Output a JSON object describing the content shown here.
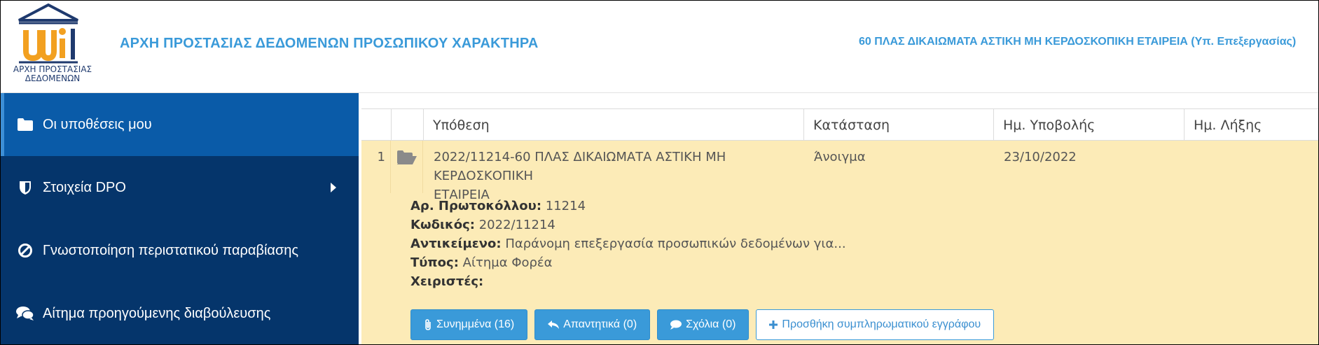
{
  "header": {
    "logo_caption_line1": "ΑΡΧΗ ΠΡΟΣΤΑΣΙΑΣ",
    "logo_caption_line2": "ΔΕΔΟΜΕΝΩΝ",
    "site_title": "ΑΡΧΗ ΠΡΟΣΤΑΣΙΑΣ ΔΕΔΟΜΕΝΩΝ ΠΡΟΣΩΠΙΚΟΥ ΧΑΡΑΚΤΗΡΑ",
    "org_title": "60 ΠΛΑΣ ΔΙΚΑΙΩΜΑΤΑ ΑΣΤΙΚΗ ΜΗ ΚΕΡΔΟΣΚΟΠΙΚΗ ΕΤΑΙΡΕΙΑ (Υπ. Επεξεργασίας)"
  },
  "sidebar": {
    "items": [
      {
        "label": "Οι υποθέσεις μου",
        "icon": "folder-icon",
        "active": true
      },
      {
        "label": "Στοιχεία DPO",
        "icon": "shield-icon",
        "has_submenu": true
      },
      {
        "label": "Γνωστοποίηση περιστατικού παραβίασης",
        "icon": "ban-icon"
      },
      {
        "label": "Αίτημα προηγούμενης διαβούλευσης",
        "icon": "comments-icon"
      }
    ]
  },
  "table": {
    "columns": [
      "",
      "",
      "Υπόθεση",
      "Κατάσταση",
      "Ημ. Υποβολής",
      "Ημ. Λήξης"
    ],
    "rows": [
      {
        "num": "1",
        "case_line1": "2022/11214-60 ΠΛΑΣ ΔΙΚΑΙΩΜΑΤΑ ΑΣΤΙΚΗ ΜΗ ΚΕΡΔΟΣΚΟΠΙΚΗ",
        "case_line2": "ΕΤΑΙΡΕΙΑ",
        "status": "Άνοιγμα",
        "submitted": "23/10/2022",
        "expires": "",
        "details": {
          "protocol_label": "Αρ. Πρωτοκόλλου:",
          "protocol_value": "11214",
          "code_label": "Κωδικός:",
          "code_value": "2022/11214",
          "subject_label": "Αντικείμενο:",
          "subject_value": "Παράνομη επεξεργασία προσωπικών δεδομένων για...",
          "type_label": "Τύπος:",
          "type_value": "Αίτημα Φορέα",
          "handlers_label": "Χειριστές:",
          "handlers_value": ""
        },
        "actions": {
          "attachments": "Συνημμένα (16)",
          "replies": "Απαντητικά (0)",
          "comments": "Σχόλια (0)",
          "add_doc": "Προσθήκη συμπληρωματικού εγγράφου"
        }
      }
    ]
  },
  "colors": {
    "sidebar_bg": "#05356b",
    "sidebar_active": "#0a5ba8",
    "accent": "#3a9ad9",
    "row_highlight": "#fcebb7"
  }
}
